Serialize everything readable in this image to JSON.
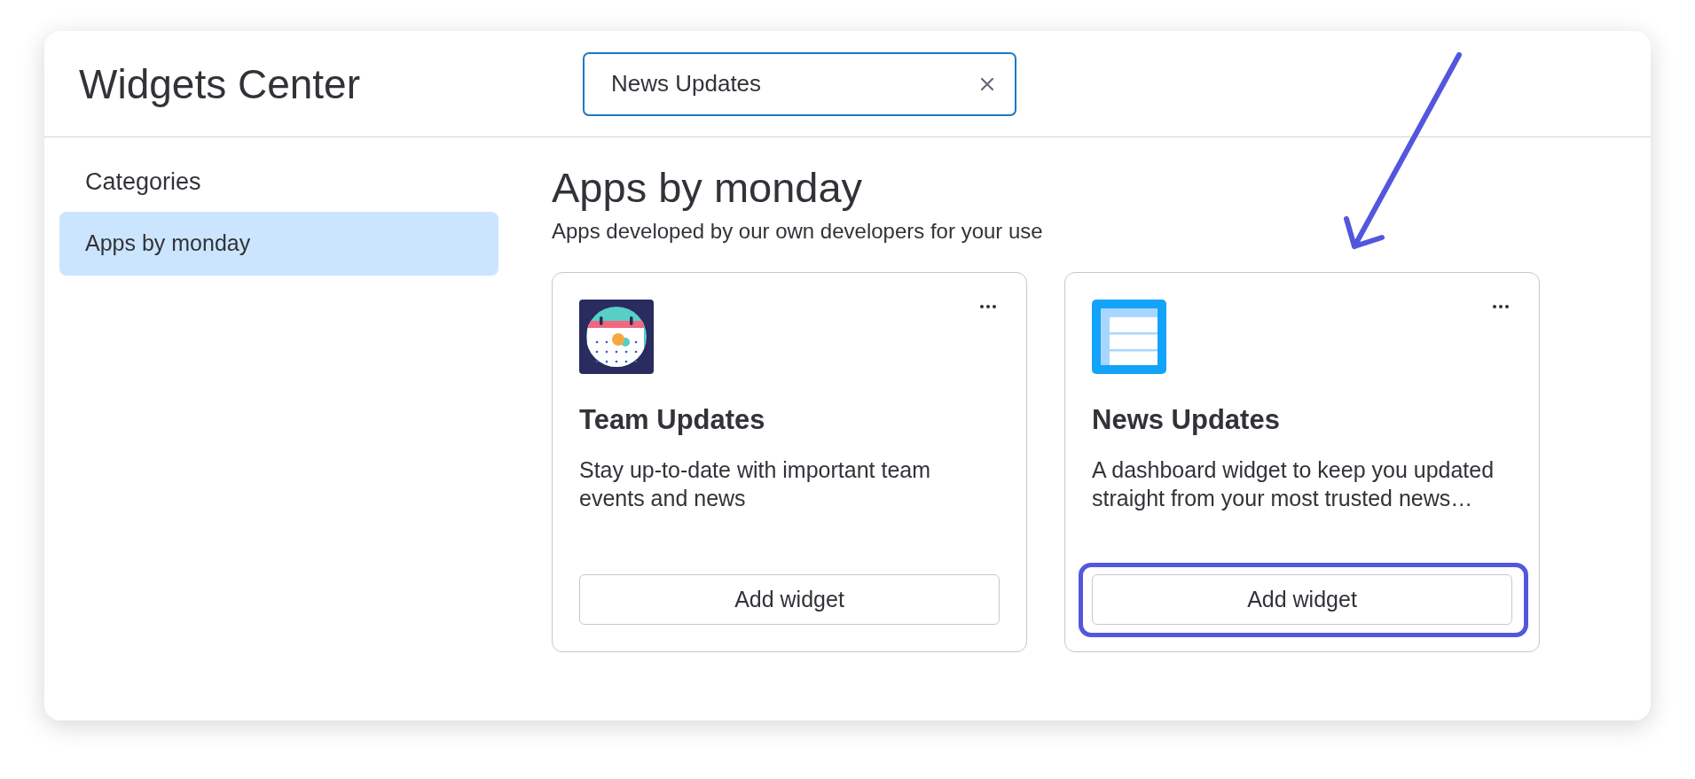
{
  "window": {
    "title": "Widgets Center"
  },
  "search": {
    "value": "News Updates"
  },
  "sidebar": {
    "heading": "Categories",
    "items": [
      {
        "label": "Apps by monday",
        "selected": true
      }
    ]
  },
  "section": {
    "title": "Apps by monday",
    "subtitle": "Apps developed by our own developers for your use"
  },
  "cards": [
    {
      "kind": "calendar",
      "title": "Team Updates",
      "description": "Stay up-to-date with important team events and news",
      "button": "Add widget",
      "highlighted": false
    },
    {
      "kind": "table",
      "title": "News Updates",
      "description": "A dashboard widget to keep you updated straight from your most trusted news…",
      "button": "Add widget",
      "highlighted": true
    }
  ]
}
